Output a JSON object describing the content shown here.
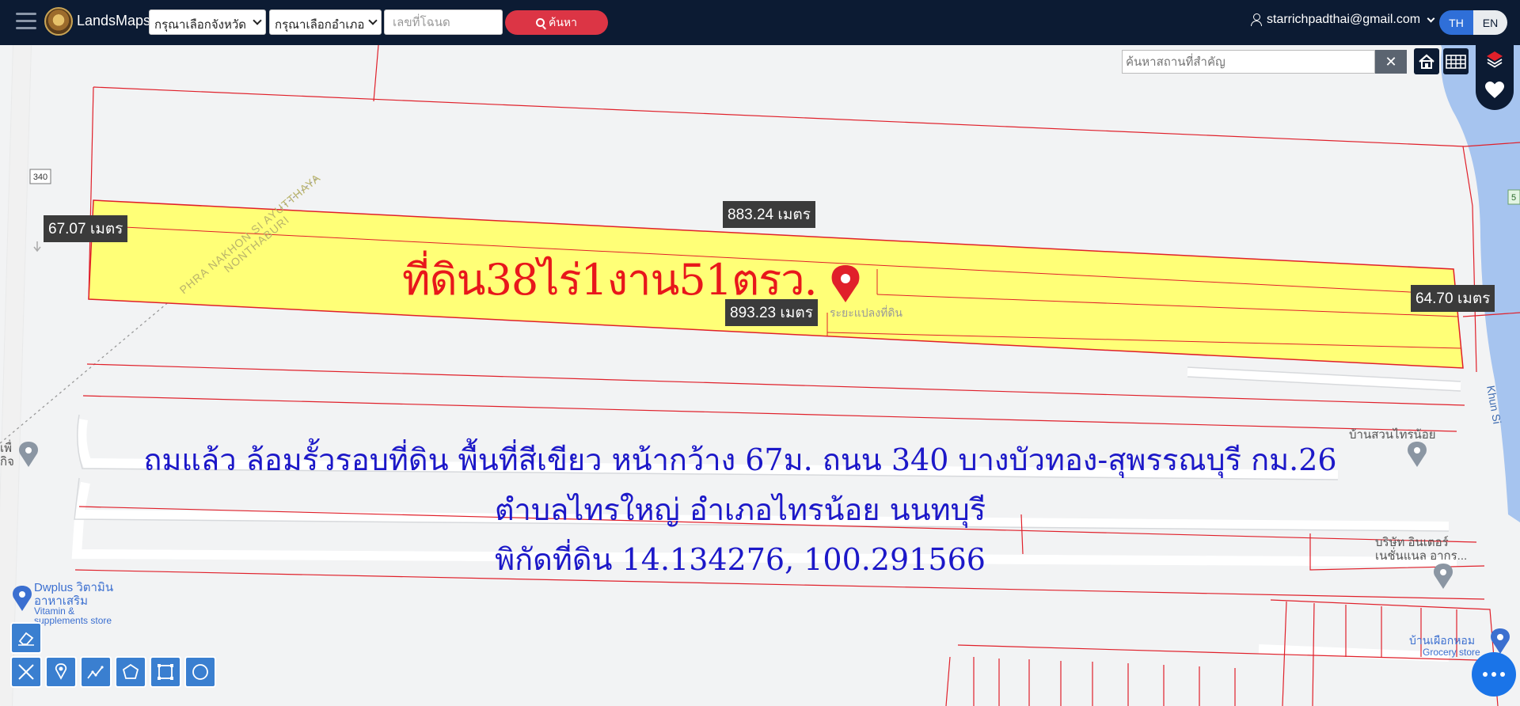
{
  "header": {
    "brand": "LandsMaps",
    "province_select": "กรุณาเลือกจังหวัด",
    "district_select": "กรุณาเลือกอำเภอ",
    "deed_placeholder": "เลขที่โฉนด",
    "search_label": "ค้นหา",
    "user_email": "starrichpadthai@gmail.com",
    "lang_th": "TH",
    "lang_en": "EN"
  },
  "map_search": {
    "placeholder": "ค้นหาสถานที่สำคัญ"
  },
  "map": {
    "distances": {
      "left": "67.07 เมตร",
      "top": "883.24 เมตร",
      "bottom": "893.23 เมตร",
      "right": "64.70 เมตร"
    },
    "parcel_label": "ระยะแปลงที่ดิน",
    "road_number": "340",
    "province_boundary_1": "PHRA NAKHON SI AYUTTHAYA",
    "province_boundary_2": "NONTHABURI",
    "river": "Khun Si",
    "edge_label": "5",
    "edge_poi": "เพื่\nกิจ",
    "land_title": "ที่ดิน38ไร่1งาน51ตรว.",
    "description_line1": "ถมแล้ว ล้อมรั้วรอบที่ดิน พื้นที่สีเขียว หน้ากว้าง 67ม. ถนน 340 บางบัวทอง-สุพรรณบุรี กม.26",
    "description_line2": "ตำบลไทรใหญ่ อำเภอไทรน้อย นนทบุรี",
    "description_line3": "พิกัดที่ดิน 14.134276, 100.291566",
    "pois": {
      "ban_suan": "บ้านสวนไทรน้อย",
      "company_1": "บริษัท อินเตอร์",
      "company_2": "เนชั่นแนล อากร...",
      "dwplus_1": "Dwplus วิตามิน",
      "dwplus_2": "อาหาเสริม",
      "dwplus_3": "Vitamin &",
      "dwplus_4": "supplements store",
      "grocery_1": "บ้านเผือกหอม",
      "grocery_2": "Grocery store"
    }
  },
  "colors": {
    "topbar": "#0c1b33",
    "parcel_fill": "#ffff77",
    "parcel_line": "#e0202a",
    "river": "#a6c4ef",
    "accent": "#dc3545",
    "title_red": "#e8171b",
    "desc_blue": "#1c18c8"
  }
}
